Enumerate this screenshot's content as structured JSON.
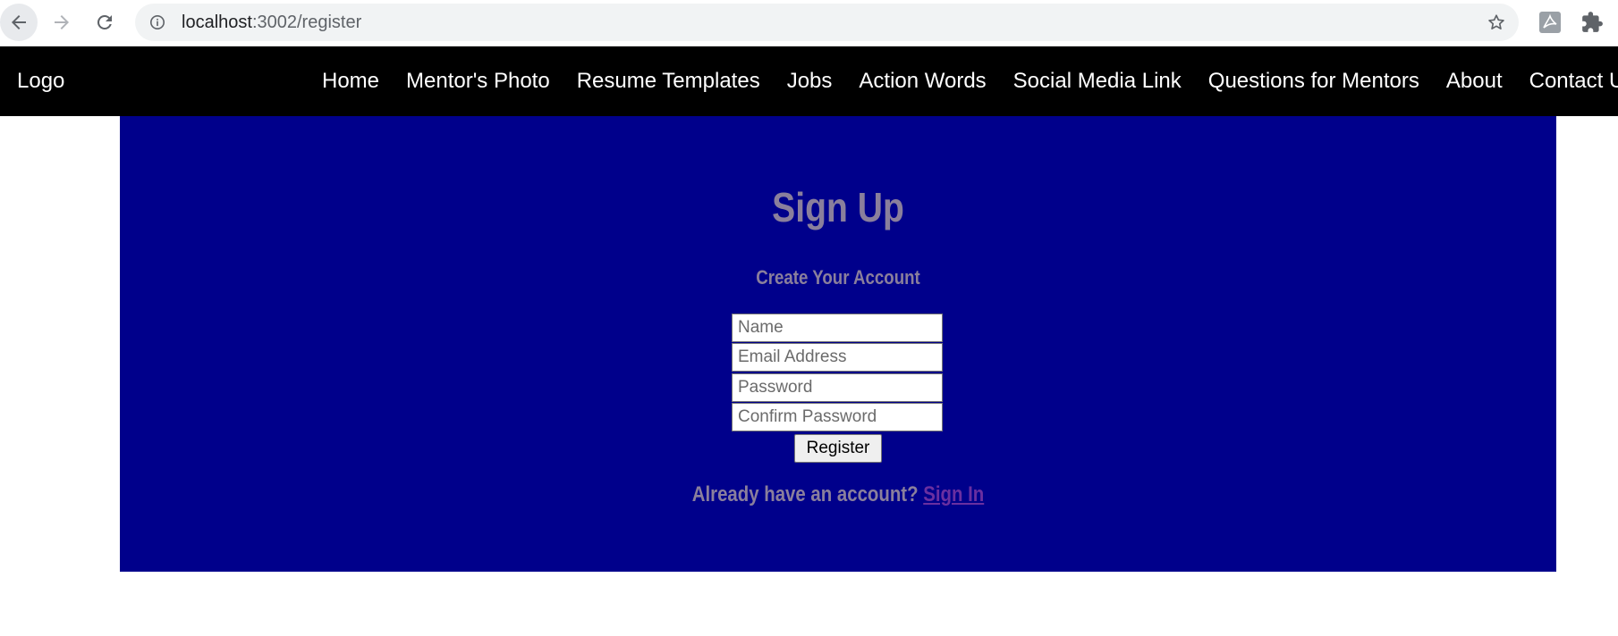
{
  "browser": {
    "url_host": "localhost",
    "url_path": ":3002/register",
    "icons": [
      "back-arrow-icon",
      "forward-arrow-icon",
      "reload-icon",
      "info-icon",
      "star-icon",
      "pdf-extension-icon",
      "puzzle-extension-icon"
    ]
  },
  "navbar": {
    "logo": "Logo",
    "items": [
      {
        "label": "Home"
      },
      {
        "label": "Mentor's Photo"
      },
      {
        "label": "Resume Templates"
      },
      {
        "label": "Jobs"
      },
      {
        "label": "Action Words"
      },
      {
        "label": "Social Media Link"
      },
      {
        "label": "Questions for Mentors"
      },
      {
        "label": "About"
      },
      {
        "label": "Contact Us"
      }
    ]
  },
  "signup": {
    "title": "Sign Up",
    "subtitle": "Create Your Account",
    "name_placeholder": "Name",
    "email_placeholder": "Email Address",
    "password_placeholder": "Password",
    "confirm_placeholder": "Confirm Password",
    "register_label": "Register",
    "already_text": "Already have an account?",
    "signin_label": "Sign In"
  },
  "colors": {
    "navbar_bg": "#000000",
    "panel_bg": "#00008b",
    "heading_text": "#8a7f9c",
    "link_text": "#6a2fa0"
  }
}
